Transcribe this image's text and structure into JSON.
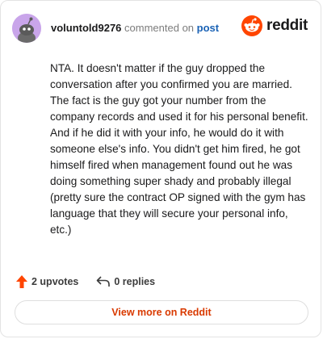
{
  "header": {
    "username": "voluntold9276",
    "action_text": "commented on",
    "post_link": "post",
    "logo_text": "reddit"
  },
  "comment": {
    "text": "NTA. It doesn't matter if the guy dropped the conversation after you confirmed you are married. The fact is the guy got your number from the company records and used it for his personal benefit. And if he did it with your info, he would do it with someone else's info. You didn't get him fired, he got himself fired when management found out he was doing something super shady and probably illegal (pretty sure the contract OP signed with the gym has language that they will secure your personal info, etc.)"
  },
  "actions": {
    "upvotes_label": "2 upvotes",
    "replies_label": "0 replies"
  },
  "footer": {
    "view_more_label": "View more on Reddit"
  },
  "colors": {
    "reddit_orange": "#ff4500",
    "link_blue": "#1a62b5",
    "avatar_bg": "#c9a5ea"
  },
  "icons": [
    "snoo-avatar-icon",
    "reddit-logo-icon",
    "upvote-arrow-icon",
    "reply-arrow-icon"
  ]
}
